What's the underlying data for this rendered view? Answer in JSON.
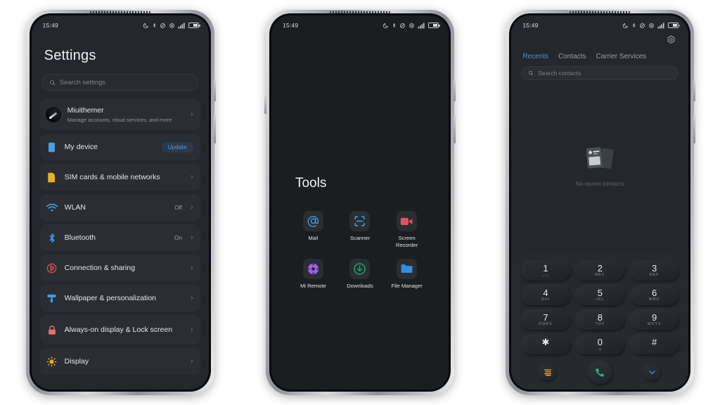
{
  "status_bar": {
    "time": "15:49",
    "icons": [
      "moon-icon",
      "bluetooth-icon",
      "dnd-icon",
      "alarm-icon",
      "signal-icon",
      "battery-icon"
    ]
  },
  "phone1": {
    "title": "Settings",
    "search": {
      "placeholder": "Search settings",
      "icon": "search-icon"
    },
    "items": [
      {
        "label": "Miuithemer",
        "sub": "Manage accounts, cloud services, and more",
        "icon": "account-avatar",
        "value": "",
        "badge": "",
        "chevron": "›",
        "color": "#0b0d10"
      },
      {
        "label": "My device",
        "sub": "",
        "icon": "device-icon",
        "value": "",
        "badge": "Update",
        "chevron": "",
        "color": "#4a9fe0"
      },
      {
        "label": "SIM cards & mobile networks",
        "sub": "",
        "icon": "sim-icon",
        "value": "",
        "badge": "",
        "chevron": "›",
        "color": "#e8b11f"
      },
      {
        "label": "WLAN",
        "sub": "",
        "icon": "wifi-icon",
        "value": "Off",
        "badge": "",
        "chevron": "›",
        "color": "#3e9fe8"
      },
      {
        "label": "Bluetooth",
        "sub": "",
        "icon": "bluetooth-icon",
        "value": "On",
        "badge": "",
        "chevron": "›",
        "color": "#3e9fe8"
      },
      {
        "label": "Connection & sharing",
        "sub": "",
        "icon": "connection-sharing-icon",
        "value": "",
        "badge": "",
        "chevron": "›",
        "color": "#d8504e"
      },
      {
        "label": "Wallpaper & personalization",
        "sub": "",
        "icon": "wallpaper-icon",
        "value": "",
        "badge": "",
        "chevron": "›",
        "color": "#3e9fe8"
      },
      {
        "label": "Always-on display & Lock screen",
        "sub": "",
        "icon": "lock-icon",
        "value": "",
        "badge": "",
        "chevron": "›",
        "color": "#e8706a"
      },
      {
        "label": "Display",
        "sub": "",
        "icon": "brightness-icon",
        "value": "",
        "badge": "",
        "chevron": "›",
        "color": "#e8b11f"
      }
    ]
  },
  "phone2": {
    "folder_title": "Tools",
    "apps": [
      {
        "label": "Mail",
        "icon": "mail-at-icon",
        "color": "#3e9fe8"
      },
      {
        "label": "Scanner",
        "icon": "scanner-icon",
        "color": "#3e9fe8"
      },
      {
        "label": "Screen Recorder",
        "icon": "screen-recorder-icon",
        "color": "#e3505c"
      },
      {
        "label": "Mi Remote",
        "icon": "mi-remote-icon",
        "color": "#9a63f0"
      },
      {
        "label": "Downloads",
        "icon": "downloads-icon",
        "color": "#1fa86a"
      },
      {
        "label": "File Manager",
        "icon": "file-manager-icon",
        "color": "#2f8fe0"
      }
    ]
  },
  "phone3": {
    "settings_icon": "hex-gear-icon",
    "tabs": [
      {
        "label": "Recents",
        "active": true
      },
      {
        "label": "Contacts",
        "active": false
      },
      {
        "label": "Carrier Services",
        "active": false
      }
    ],
    "search": {
      "placeholder": "Search contacts",
      "icon": "search-icon"
    },
    "empty_state": {
      "text": "No recent contacts",
      "icon": "contact-cards-icon"
    },
    "keys": [
      {
        "num": "1",
        "sub": "◡◡"
      },
      {
        "num": "2",
        "sub": "ABC"
      },
      {
        "num": "3",
        "sub": "DEF"
      },
      {
        "num": "4",
        "sub": "GHI"
      },
      {
        "num": "5",
        "sub": "JKL"
      },
      {
        "num": "6",
        "sub": "MNO"
      },
      {
        "num": "7",
        "sub": "PQRS"
      },
      {
        "num": "8",
        "sub": "TUV"
      },
      {
        "num": "9",
        "sub": "WXYZ"
      },
      {
        "num": "✱",
        "sub": ","
      },
      {
        "num": "0",
        "sub": "+"
      },
      {
        "num": "#",
        "sub": ""
      }
    ],
    "actions": [
      {
        "name": "dialer-menu-button",
        "icon": "menu-lines-icon",
        "color": "#e8a93a"
      },
      {
        "name": "call-button",
        "icon": "phone-handset-icon",
        "color": "#17b97e"
      },
      {
        "name": "hide-keypad-button",
        "icon": "chevron-down-icon",
        "color": "#2f8fe0"
      }
    ]
  },
  "colors": {
    "page_background": "#ffffff",
    "screen_background": "#24272b",
    "folder_background": "#1b1d20",
    "row_background": "#2a2e33",
    "accent_blue": "#4b8fd6",
    "accent_green": "#17b97e",
    "accent_orange": "#e8a93a"
  }
}
